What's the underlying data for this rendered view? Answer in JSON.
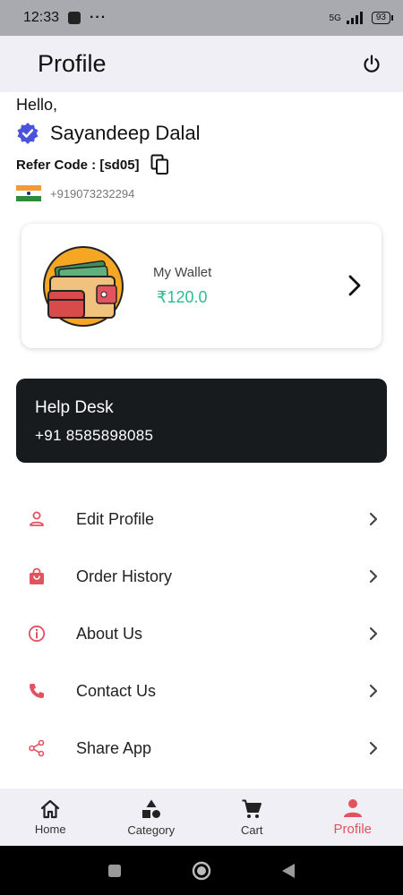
{
  "status_bar": {
    "time": "12:33",
    "dots": "···",
    "network": "5G",
    "battery": "93"
  },
  "app_bar": {
    "title": "Profile"
  },
  "profile": {
    "greeting": "Hello,",
    "name": "Sayandeep Dalal",
    "refer_code": "Refer Code : [sd05]",
    "phone": "+919073232294"
  },
  "wallet": {
    "label": "My Wallet",
    "amount": "₹120.0"
  },
  "help_desk": {
    "title": "Help Desk",
    "phone": "+91 8585898085"
  },
  "menu": [
    {
      "label": "Edit Profile",
      "icon": "person-icon"
    },
    {
      "label": "Order History",
      "icon": "shopping-bag-icon"
    },
    {
      "label": "About Us",
      "icon": "info-icon"
    },
    {
      "label": "Contact Us",
      "icon": "phone-icon"
    },
    {
      "label": "Share App",
      "icon": "share-icon"
    }
  ],
  "bottom_nav": [
    {
      "label": "Home",
      "icon": "home-icon"
    },
    {
      "label": "Category",
      "icon": "category-icon"
    },
    {
      "label": "Cart",
      "icon": "cart-icon"
    },
    {
      "label": "Profile",
      "icon": "person-icon",
      "active": true
    }
  ],
  "colors": {
    "accent": "#e2525f",
    "wallet_amount": "#2ebd8e",
    "help_desk_bg": "#181b1e",
    "app_bar_bg": "#efeff5"
  }
}
